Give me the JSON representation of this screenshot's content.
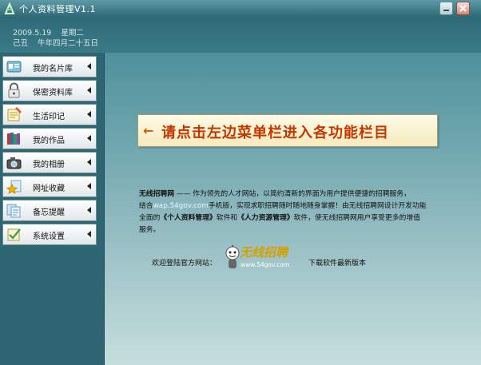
{
  "window": {
    "title": "个人资料管理V1.1"
  },
  "header": {
    "date_solar": "2009.5.19",
    "weekday": "星期二",
    "ganzhi": "己丑",
    "lunar_date": "牛年四月二十五日"
  },
  "sidebar": {
    "items": [
      {
        "label": "我的名片库",
        "icon": "business-card-icon"
      },
      {
        "label": "保密资料库",
        "icon": "padlock-icon"
      },
      {
        "label": "生活印记",
        "icon": "notebook-pen-icon"
      },
      {
        "label": "我的作品",
        "icon": "books-icon"
      },
      {
        "label": "我的相册",
        "icon": "camera-icon"
      },
      {
        "label": "网址收藏",
        "icon": "star-icon"
      },
      {
        "label": "备忘提醒",
        "icon": "notes-icon"
      },
      {
        "label": "系统设置",
        "icon": "settings-check-icon"
      }
    ]
  },
  "banner": {
    "arrow": "←",
    "text": "请点击左边菜单栏进入各功能栏目"
  },
  "description": {
    "brand": "无线招聘网",
    "part1": " —— 作为领先的人才网站，以简约清新的界面为用户提供便捷的招聘服务，",
    "part2_prefix": "结合",
    "wap_url": "wap.54gov.com",
    "part2_suffix": "手机版，实现求职招聘随时随地随身掌握！由无线招聘网设计开发功能",
    "part3_prefix": "全面的",
    "product1": "《个人资料管理》",
    "part3_mid": "软件和",
    "product2": "《人力资源管理》",
    "part3_suffix": "软件，使无线招聘网用户享受更多的增值",
    "part4": "服务。"
  },
  "footer": {
    "welcome": "欢迎登陆官方网站：",
    "logo_title": "无线招聘",
    "logo_url": "www.54gov.com",
    "download": "下载软件最新版本"
  },
  "colors": {
    "banner_text": "#c43600",
    "logo_accent": "#d6a000",
    "titlebar": "#2d6774"
  }
}
